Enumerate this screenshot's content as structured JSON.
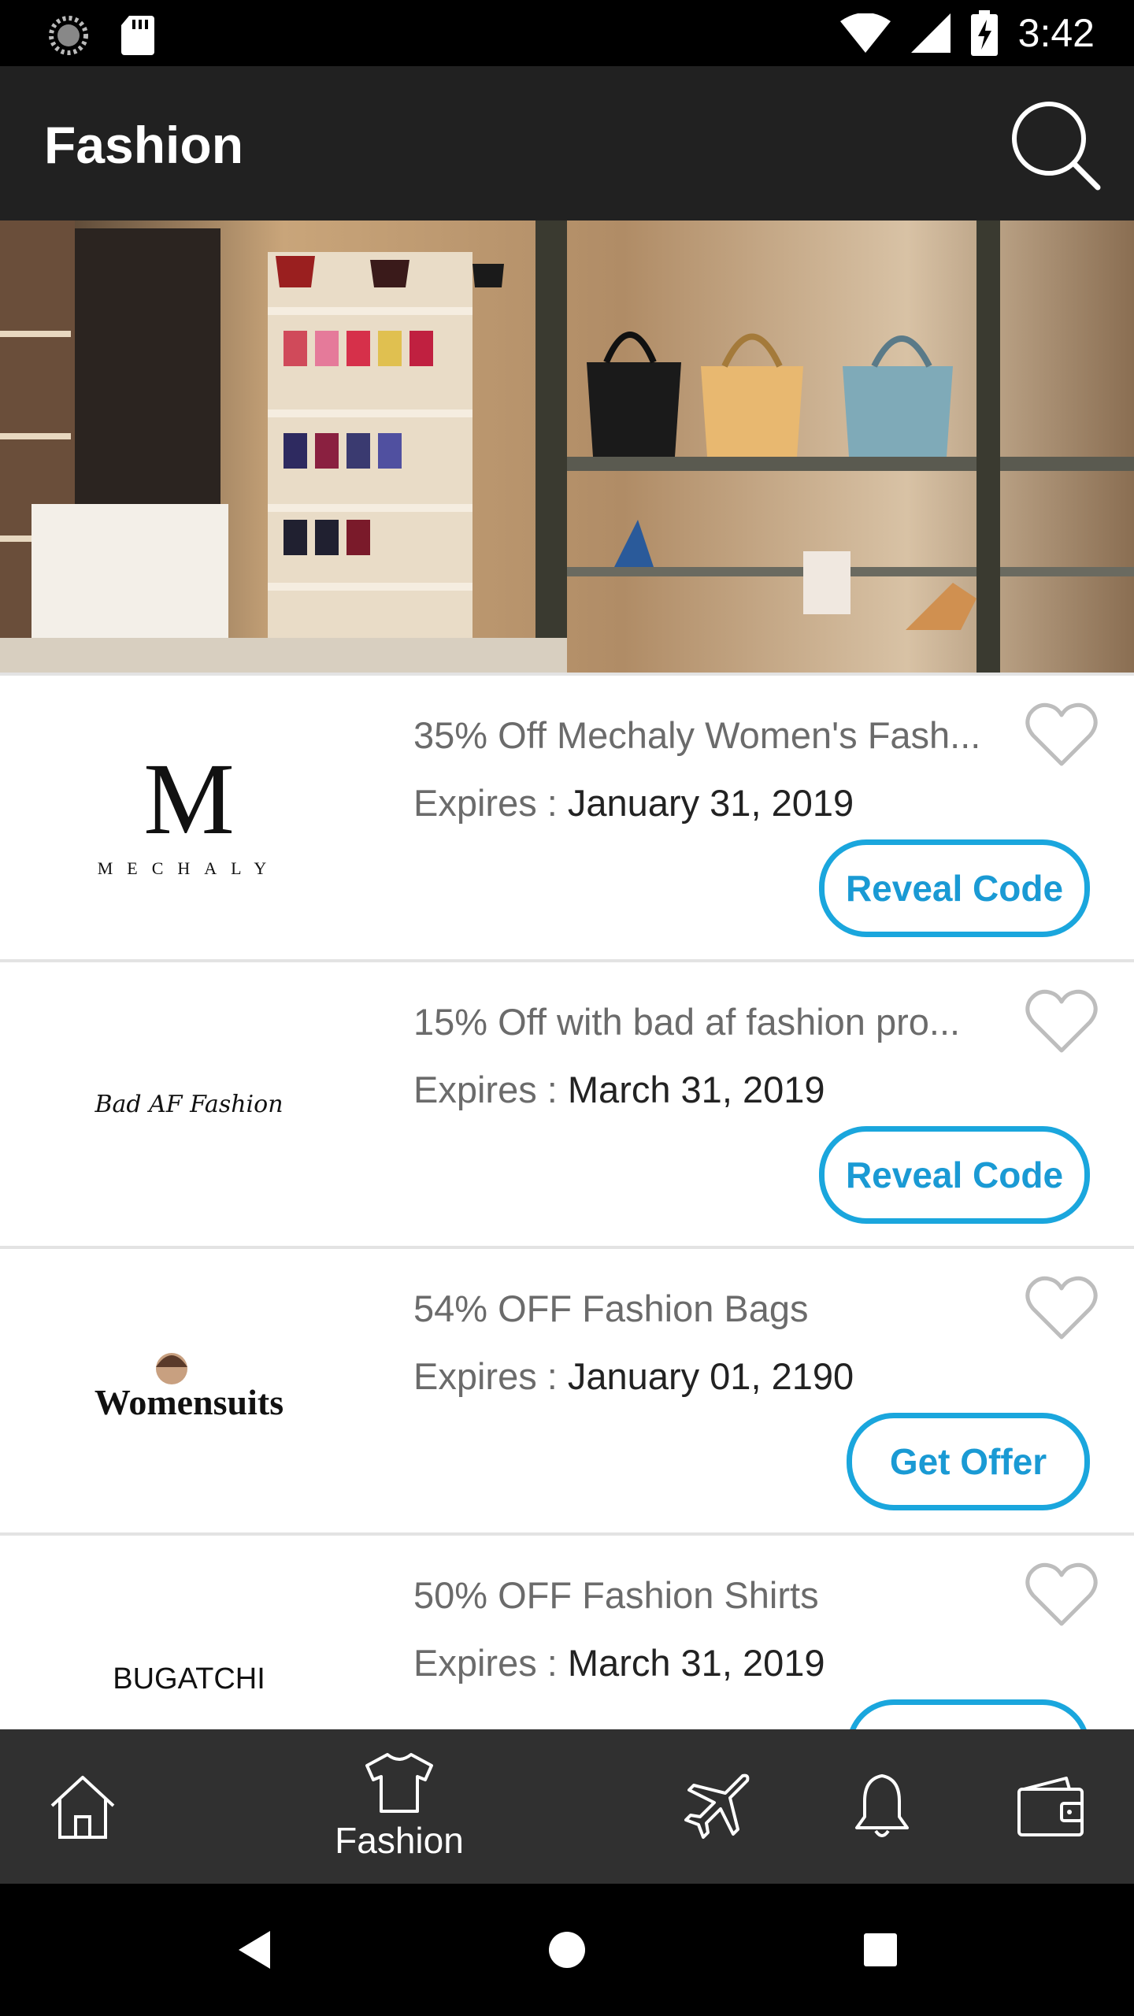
{
  "status_bar": {
    "time": "3:42"
  },
  "app_bar": {
    "title": "Fashion"
  },
  "offers": [
    {
      "brand": "MECHALY",
      "brand_mark": "M",
      "title": "35% Off Mechaly Women's Fash...",
      "expires_label": "Expires : ",
      "expires_date": "January 31, 2019",
      "cta": "Reveal Code"
    },
    {
      "brand": "Bad AF Fashion",
      "title": "15% Off with bad af fashion pro...",
      "expires_label": "Expires : ",
      "expires_date": "March 31, 2019",
      "cta": "Reveal Code"
    },
    {
      "brand": "Womensuits",
      "title": "54% OFF Fashion Bags",
      "expires_label": "Expires : ",
      "expires_date": "January 01, 2190",
      "cta": "Get Offer"
    },
    {
      "brand": "BUGATCHI",
      "title": "50% OFF Fashion Shirts",
      "expires_label": "Expires : ",
      "expires_date": "March 31, 2019",
      "cta": ""
    }
  ],
  "bottom_nav": {
    "items": [
      {
        "icon": "home-icon",
        "label": ""
      },
      {
        "icon": "tshirt-icon",
        "label": "Fashion",
        "active": true
      },
      {
        "icon": "airplane-icon",
        "label": ""
      },
      {
        "icon": "bell-icon",
        "label": ""
      },
      {
        "icon": "wallet-icon",
        "label": ""
      }
    ]
  },
  "colors": {
    "app_bar": "#212121",
    "accent": "#1aa6dd",
    "bottom_nav": "#303030"
  }
}
